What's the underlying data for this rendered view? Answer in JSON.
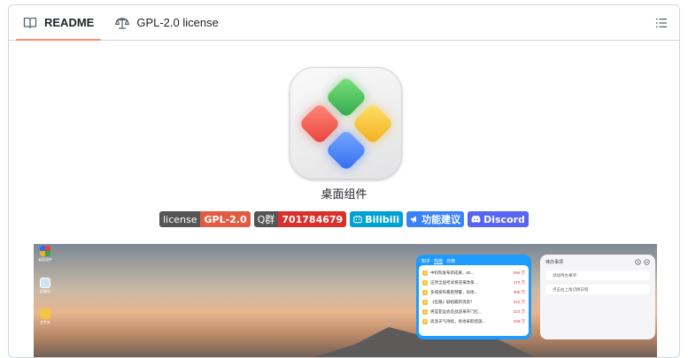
{
  "tabs": [
    {
      "label": "README",
      "icon": "book-icon",
      "active": true
    },
    {
      "label": "GPL-2.0 license",
      "icon": "scale-icon",
      "active": false
    }
  ],
  "toc_icon": "list-unordered-icon",
  "app": {
    "title": "桌面组件",
    "logo_icon": "app-logo-icon"
  },
  "badges": [
    {
      "left": "license",
      "right": "GPL-2.0",
      "color": "#e05d44"
    },
    {
      "left": "Q群",
      "right": "701784679",
      "color": "#d9302c"
    },
    {
      "right": "Bilibili",
      "color": "#00a1d6",
      "icon": "tv-icon"
    },
    {
      "right": "功能建议",
      "color": "#3b82f6",
      "icon": "megaphone-icon"
    },
    {
      "right": "Discord",
      "color": "#5865f2",
      "icon": "discord-icon"
    }
  ],
  "screenshot": {
    "desktop_icons": [
      "桌面组件",
      "回收站",
      "文件夹"
    ],
    "hot": {
      "tabs": [
        "知乎",
        "热榜",
        "日榜"
      ],
      "items": [
        {
          "n": "1",
          "text": "中科院发布新成果，60...",
          "count": "596 万"
        },
        {
          "n": "2",
          "text": "这项全国考试将迎来改革...",
          "count": "470 万"
        },
        {
          "n": "3",
          "text": "多城发布暴雨预警，局地...",
          "count": "395 万"
        },
        {
          "n": "4",
          "text": "《狂飙》剧组最新消息？",
          "count": "342 万"
        },
        {
          "n": "5",
          "text": "男篮亚运会首战迎来开门红...",
          "count": "323 万"
        },
        {
          "n": "6",
          "text": "高温天气持续，各地采取措施...",
          "count": "299 万"
        }
      ]
    },
    "todo": {
      "title": "待办事项",
      "items": [
        "添加待办事项",
        "点击右上角切换日程"
      ]
    }
  }
}
